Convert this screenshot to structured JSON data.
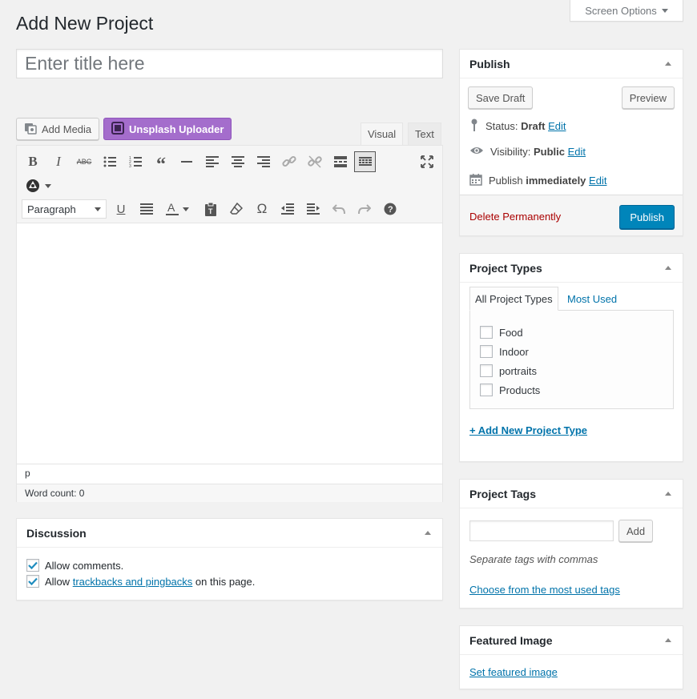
{
  "header": {
    "screen_options": "Screen Options",
    "page_title": "Add New Project"
  },
  "title_field": {
    "placeholder": "Enter title here",
    "value": ""
  },
  "media_buttons": {
    "add_media": "Add Media",
    "unsplash": "Unsplash Uploader"
  },
  "editor": {
    "tabs": [
      "Visual",
      "Text"
    ],
    "active_tab": "Visual",
    "format_select": "Paragraph",
    "path": "p",
    "word_count": "Word count: 0",
    "toolbar_row1": [
      "bold",
      "italic",
      "strikethrough",
      "bullet-list",
      "numbered-list",
      "blockquote",
      "horizontal-rule",
      "align-left",
      "align-center",
      "align-right",
      "insert-link",
      "remove-link",
      "read-more",
      "toolbar-toggle",
      "fullscreen"
    ],
    "toolbar_row2": [
      "underline",
      "justify",
      "text-color",
      "paste-as-text",
      "clear-formatting",
      "special-character",
      "outdent",
      "indent",
      "undo",
      "redo",
      "help"
    ]
  },
  "discussion": {
    "title": "Discussion",
    "allow_comments": "Allow comments.",
    "allow_pre": "Allow",
    "trackbacks_link": "trackbacks and pingbacks",
    "allow_post": "on this page."
  },
  "publish": {
    "title": "Publish",
    "save_draft": "Save Draft",
    "preview": "Preview",
    "status_label": "Status:",
    "status_value": "Draft",
    "visibility_label": "Visibility:",
    "visibility_value": "Public",
    "publish_label": "Publish",
    "publish_value": "immediately",
    "edit": "Edit",
    "delete": "Delete Permanently",
    "publish_button": "Publish"
  },
  "project_types": {
    "title": "Project Types",
    "tab_all": "All Project Types",
    "tab_most_used": "Most Used",
    "items": [
      "Food",
      "Indoor",
      "portraits",
      "Products"
    ],
    "add_new": "+ Add New Project Type"
  },
  "project_tags": {
    "title": "Project Tags",
    "add_button": "Add",
    "hint": "Separate tags with commas",
    "choose_link": "Choose from the most used tags"
  },
  "featured_image": {
    "title": "Featured Image",
    "set_link": "Set featured image"
  },
  "colors": {
    "link": "#0073aa",
    "primary_button": "#0085ba",
    "unsplash": "#a46dcc",
    "delete": "#aa0000"
  }
}
